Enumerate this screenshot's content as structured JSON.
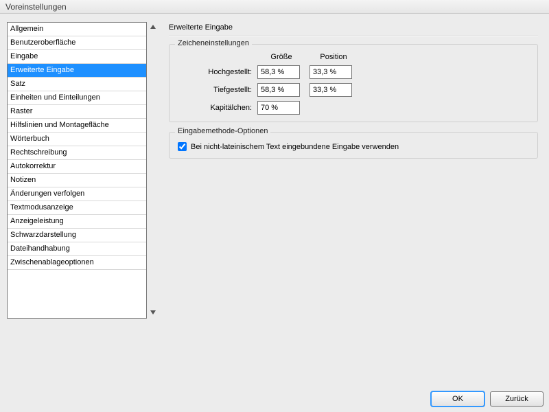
{
  "window": {
    "title": "Voreinstellungen"
  },
  "sidebar": {
    "items": [
      {
        "label": "Allgemein"
      },
      {
        "label": "Benutzeroberfläche"
      },
      {
        "label": "Eingabe"
      },
      {
        "label": "Erweiterte Eingabe"
      },
      {
        "label": "Satz"
      },
      {
        "label": "Einheiten und Einteilungen"
      },
      {
        "label": "Raster"
      },
      {
        "label": "Hilfslinien und Montagefläche"
      },
      {
        "label": "Wörterbuch"
      },
      {
        "label": "Rechtschreibung"
      },
      {
        "label": "Autokorrektur"
      },
      {
        "label": "Notizen"
      },
      {
        "label": "Änderungen verfolgen"
      },
      {
        "label": "Textmodusanzeige"
      },
      {
        "label": "Anzeigeleistung"
      },
      {
        "label": "Schwarzdarstellung"
      },
      {
        "label": "Dateihandhabung"
      },
      {
        "label": "Zwischenablageoptionen"
      }
    ],
    "selected_index": 3
  },
  "page": {
    "title": "Erweiterte Eingabe",
    "char_settings": {
      "group_label": "Zeicheneinstellungen",
      "headers": {
        "size": "Größe",
        "position": "Position"
      },
      "rows": {
        "superscript": {
          "label": "Hochgestellt:",
          "size": "58,3 %",
          "position": "33,3 %"
        },
        "subscript": {
          "label": "Tiefgestellt:",
          "size": "58,3 %",
          "position": "33,3 %"
        },
        "smallcaps": {
          "label": "Kapitälchen:",
          "size": "70 %"
        }
      }
    },
    "ime": {
      "group_label": "Eingabemethode-Optionen",
      "inline_label": "Bei nicht-lateinischem Text eingebundene Eingabe verwenden",
      "inline_checked": true
    }
  },
  "buttons": {
    "ok": "OK",
    "back": "Zurück"
  }
}
